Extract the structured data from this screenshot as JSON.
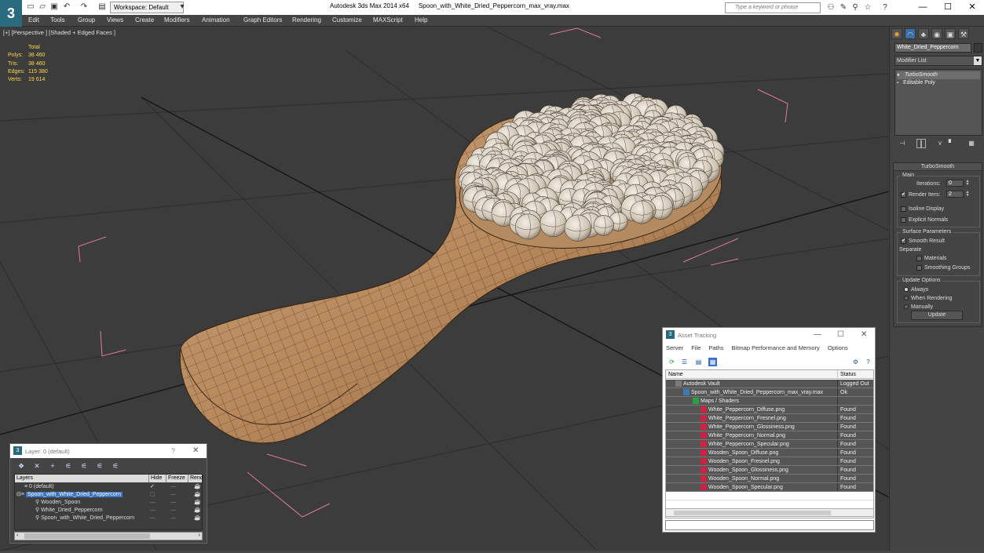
{
  "titlebar": {
    "workspace": "Workspace: Default",
    "app": "Autodesk 3ds Max  2014 x64",
    "file": "Spoon_with_White_Dried_Peppercorn_max_vray.max",
    "search_placeholder": "Type a keyword or phrase",
    "minimize": "—",
    "maximize": "☐",
    "close": "✕"
  },
  "menubar": [
    "Edit",
    "Tools",
    "Group",
    "Views",
    "Create",
    "Modifiers",
    "Animation",
    "Graph Editors",
    "Rendering",
    "Customize",
    "MAXScript",
    "Help"
  ],
  "viewport": {
    "label": "[+] [Perspective ] [Shaded + Edged Faces ]",
    "stats_header": "Total",
    "stats": [
      {
        "label": "Polys:",
        "value": "38 460"
      },
      {
        "label": "Tris:",
        "value": "38 460"
      },
      {
        "label": "Edges:",
        "value": "115 380"
      },
      {
        "label": "Verts:",
        "value": "19 614"
      }
    ]
  },
  "command_panel": {
    "object_name": "White_Dried_Peppercorn",
    "modifier_list": "Modifier List",
    "stack": [
      "TurboSmooth",
      "Editable Poly"
    ],
    "rollout_title": "TurboSmooth",
    "main_group": "Main",
    "iterations_label": "Iterations:",
    "iterations_value": "0",
    "render_iters_label": "Render Iters:",
    "render_iters_value": "2",
    "isoline_display": "Isoline Display",
    "explicit_normals": "Explicit Normals",
    "surface_group": "Surface Parameters",
    "smooth_result": "Smooth Result",
    "separate": "Separate",
    "materials": "Materials",
    "smoothing_groups": "Smoothing Groups",
    "update_group": "Update Options",
    "always": "Always",
    "when_rendering": "When Rendering",
    "manually": "Manually",
    "update_button": "Update"
  },
  "layer_window": {
    "title": "Layer: 0 (default)",
    "help": "?",
    "close": "✕",
    "columns": [
      "Layers",
      "Hide",
      "Freeze",
      "Rend"
    ],
    "rows": [
      {
        "name": "0 (default)"
      },
      {
        "name": "Spoon_with_White_Dried_Peppercorn"
      },
      {
        "name": "Wooden_Spoon"
      },
      {
        "name": "White_Dried_Peppercorn"
      },
      {
        "name": "Spoon_with_White_Dried_Peppercorn"
      }
    ]
  },
  "asset_window": {
    "title": "Asset Tracking",
    "menu": [
      "Server",
      "File",
      "Paths",
      "Bitmap Performance and Memory",
      "Options"
    ],
    "columns": [
      "Name",
      "Status"
    ],
    "rows": [
      {
        "name": "Autodesk Vault",
        "status": "Logged Out"
      },
      {
        "name": "Spoon_with_White_Dried_Peppercorn_max_vray.max",
        "status": "Ok"
      },
      {
        "name": "Maps / Shaders",
        "status": ""
      },
      {
        "name": "White_Peppercorn_Diffuse.png",
        "status": "Found"
      },
      {
        "name": "White_Peppercorn_Fresnel.png",
        "status": "Found"
      },
      {
        "name": "White_Peppercorn_Glossiness.png",
        "status": "Found"
      },
      {
        "name": "White_Peppercorn_Normal.png",
        "status": "Found"
      },
      {
        "name": "White_Peppercorn_Specular.png",
        "status": "Found"
      },
      {
        "name": "Wooden_Spoon_Diffuse.png",
        "status": "Found"
      },
      {
        "name": "Wooden_Spoon_Fresnel.png",
        "status": "Found"
      },
      {
        "name": "Wooden_Spoon_Glossiness.png",
        "status": "Found"
      },
      {
        "name": "Wooden_Spoon_Normal.png",
        "status": "Found"
      },
      {
        "name": "Wooden_Spoon_Specular.png",
        "status": "Found"
      }
    ]
  }
}
